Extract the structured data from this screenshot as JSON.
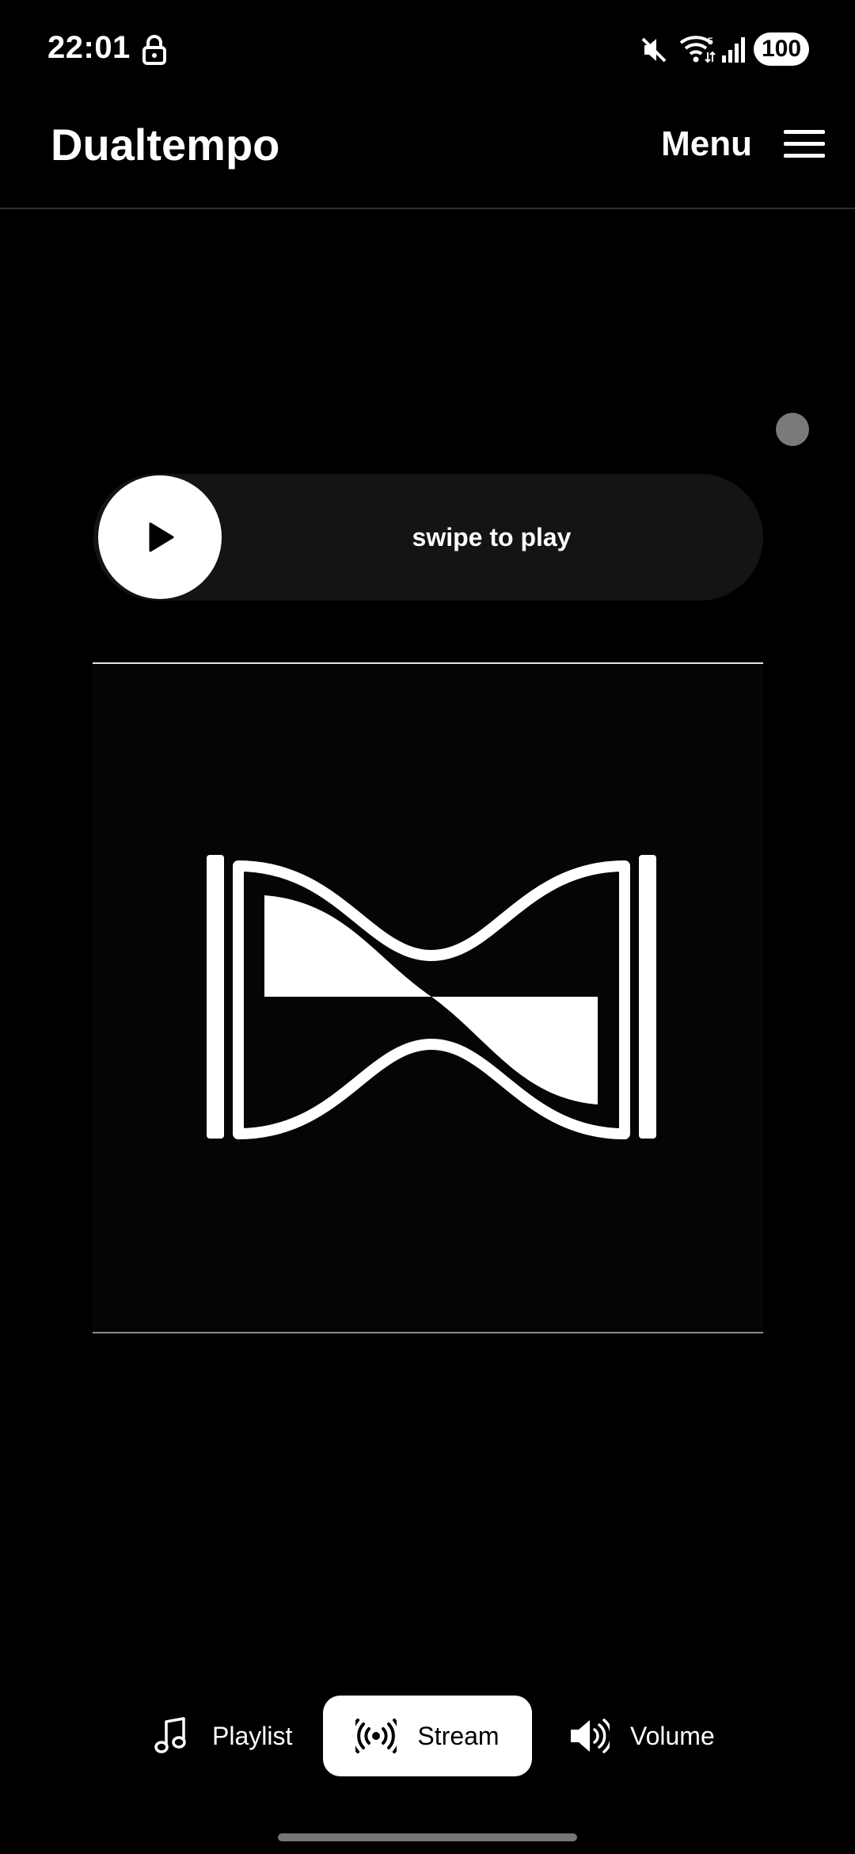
{
  "status_bar": {
    "time": "22:01",
    "battery": "100",
    "icons": [
      "lock-icon",
      "mute-icon",
      "wifi-icon",
      "signal-icon"
    ]
  },
  "header": {
    "title": "Dualtempo",
    "menu_label": "Menu"
  },
  "player": {
    "swipe_label": "swipe to play",
    "knob_icon": "play-icon"
  },
  "artwork": {
    "logo_icon": "dualtempo-logo-icon"
  },
  "bottom_nav": {
    "items": [
      {
        "label": "Playlist",
        "icon": "music-note-icon",
        "active": false
      },
      {
        "label": "Stream",
        "icon": "broadcast-icon",
        "active": true
      },
      {
        "label": "Volume",
        "icon": "volume-icon",
        "active": false
      }
    ]
  },
  "colors": {
    "background": "#000000",
    "foreground": "#ffffff",
    "swipe_track": "#141414",
    "indicator_dot": "#7a7a7a"
  }
}
